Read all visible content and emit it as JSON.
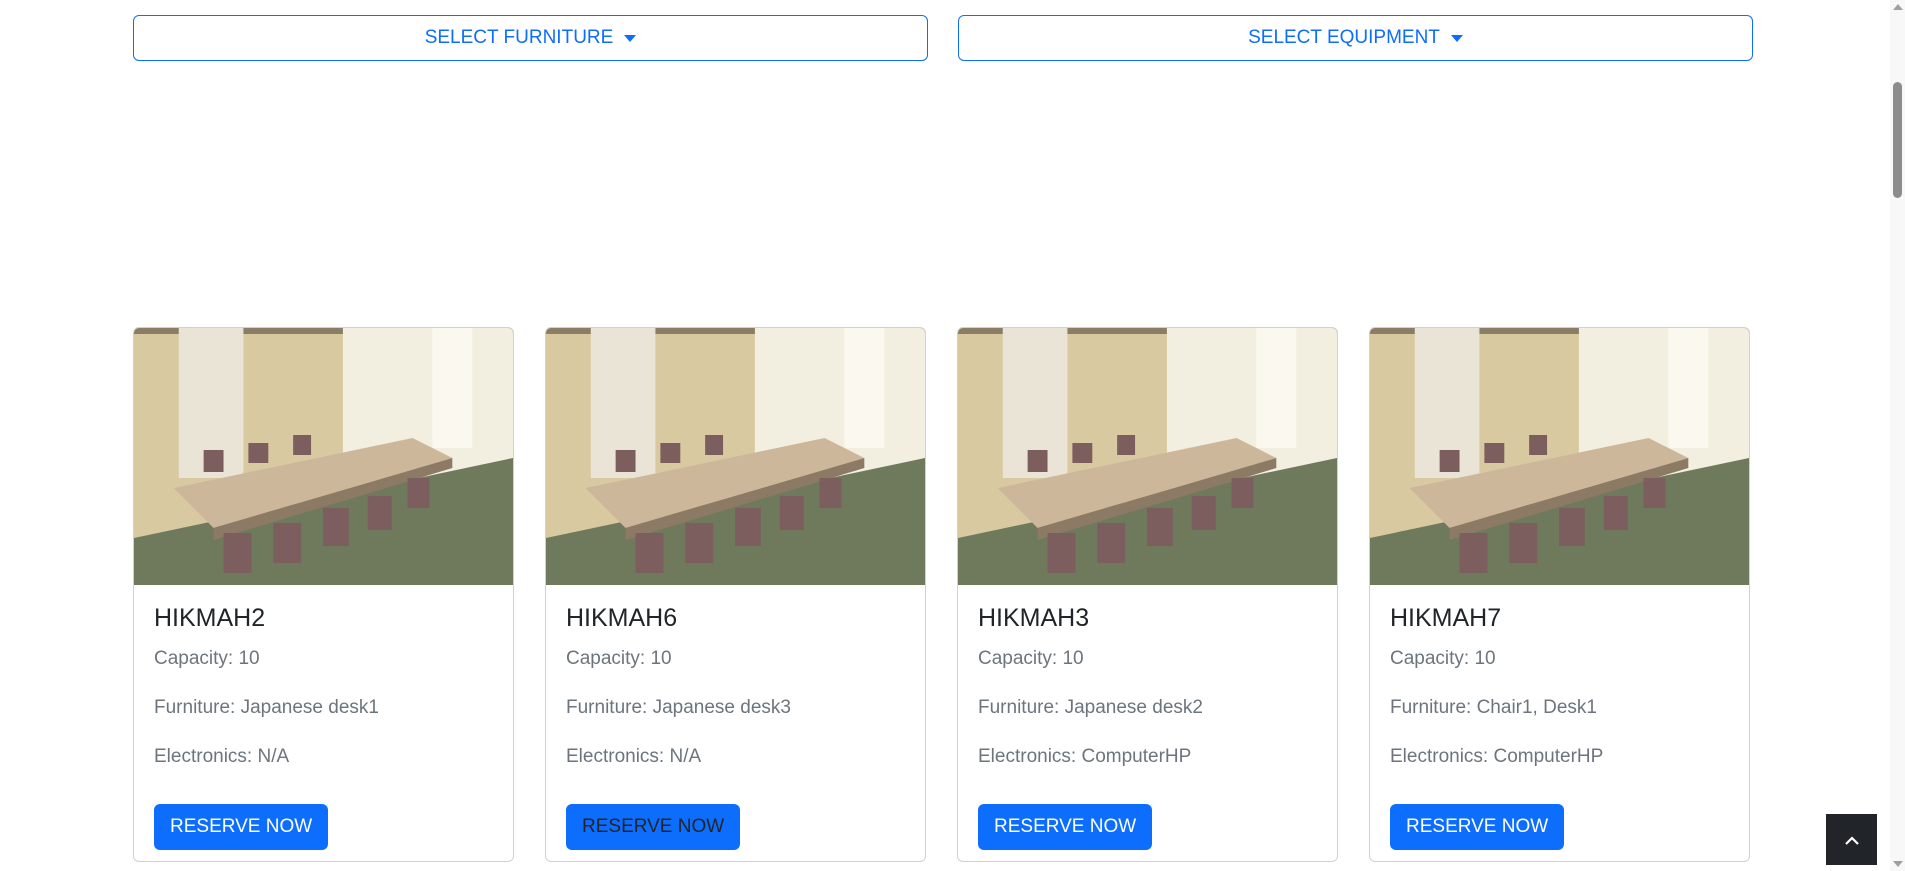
{
  "filters": {
    "furniture_label": "SELECT FURNITURE",
    "equipment_label": "SELECT EQUIPMENT"
  },
  "rooms": [
    {
      "name": "HIKMAH2",
      "capacity": "Capacity: 10",
      "furniture": "Furniture: Japanese desk1",
      "electronics": "Electronics: N/A",
      "button": "RESERVE NOW"
    },
    {
      "name": "HIKMAH6",
      "capacity": "Capacity: 10",
      "furniture": "Furniture: Japanese desk3",
      "electronics": "Electronics: N/A",
      "button": "RESERVE NOW"
    },
    {
      "name": "HIKMAH3",
      "capacity": "Capacity: 10",
      "furniture": "Furniture: Japanese desk2",
      "electronics": "Electronics: ComputerHP",
      "button": "RESERVE NOW"
    },
    {
      "name": "HIKMAH7",
      "capacity": "Capacity: 10",
      "furniture": "Furniture: Chair1, Desk1",
      "electronics": "Electronics: ComputerHP",
      "button": "RESERVE NOW"
    }
  ],
  "icons": {
    "dropdown": "caret-down-icon",
    "back_to_top": "chevron-up-icon"
  },
  "colors": {
    "primary": "#0d6efd",
    "dark": "#212529",
    "muted": "#6c757d"
  }
}
